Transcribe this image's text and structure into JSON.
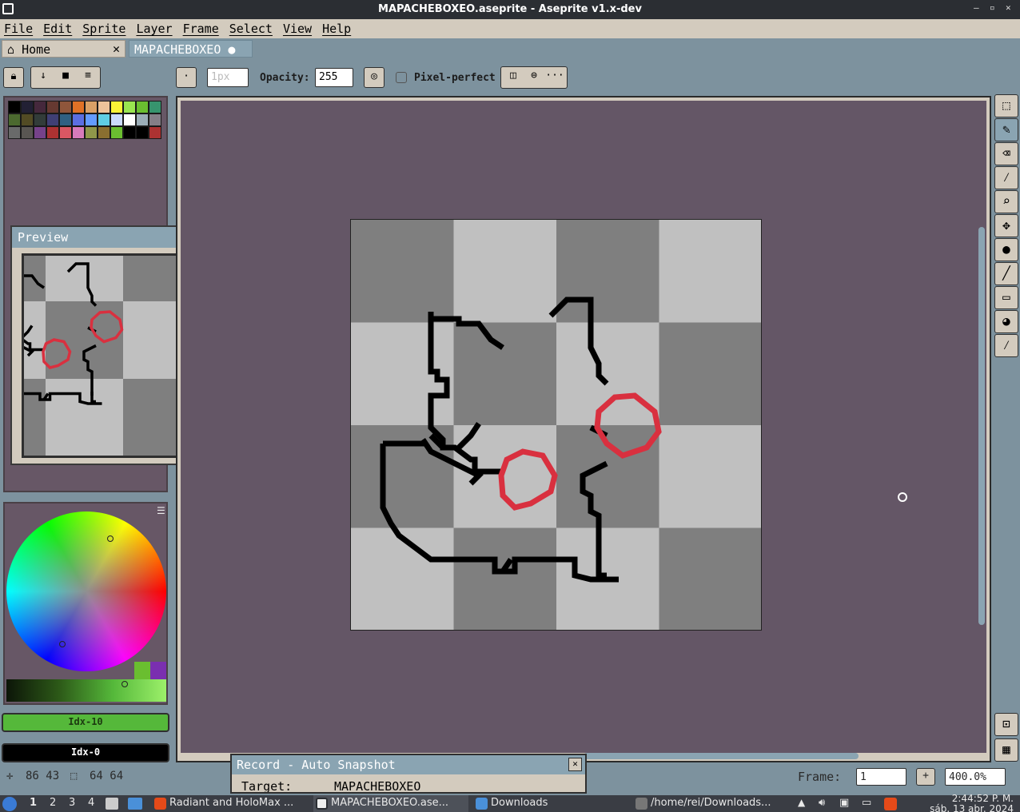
{
  "window": {
    "title": "MAPACHEBOXEO.aseprite - Aseprite v1.x-dev",
    "minimize": "–",
    "restore": "▫",
    "close": "✕"
  },
  "menu": [
    "File",
    "Edit",
    "Sprite",
    "Layer",
    "Frame",
    "Select",
    "View",
    "Help"
  ],
  "tabs": {
    "home_label": "Home",
    "home_close": "✕",
    "file_label": "MAPACHEBOXEO",
    "file_modified": "●"
  },
  "context_bar": {
    "brush_size": "1px",
    "opacity_label": "Opacity:",
    "opacity_value": "255",
    "pixel_perfect_label": "Pixel-perfect",
    "more": "···"
  },
  "palette_colors": [
    "#000000",
    "#222034",
    "#45283c",
    "#663931",
    "#8f563b",
    "#df7126",
    "#d9a066",
    "#eec39a",
    "#fbf236",
    "#99e550",
    "#6abe30",
    "#37946e",
    "#4b692f",
    "#524b24",
    "#323c39",
    "#3f3f74",
    "#306082",
    "#5b6ee1",
    "#639bff",
    "#5fcde4",
    "#cbdbfc",
    "#ffffff",
    "#9badb7",
    "#847e87",
    "#696a6a",
    "#595652",
    "#76428a",
    "#ac3232",
    "#d95763",
    "#d77bba",
    "#8f974a",
    "#8a6f30",
    "#6abe30",
    "#000000",
    "#000000",
    "#ac3232"
  ],
  "preview": {
    "title": "Preview"
  },
  "colors": {
    "fg_label": "Idx-10",
    "bg_label": "Idx-0",
    "fg": "#55b83a",
    "bg": "#000000",
    "outline": "#000000",
    "red": "#d9303f"
  },
  "status": {
    "pos_icon": "✛",
    "pos": "86 43",
    "size_icon": "⬚",
    "size": "64 64",
    "frame_label": "Frame:",
    "frame_value": "1",
    "add": "+",
    "zoom": "400.0%"
  },
  "record": {
    "title": "Record - Auto Snapshot",
    "target_label": "Target:",
    "target_value": "MAPACHEBOXEO",
    "close": "✕"
  },
  "tools": [
    "selection-tool-icon",
    "pencil-icon",
    "eraser-icon",
    "eyedropper-icon",
    "zoom-icon",
    "move-icon",
    "paint-bucket-icon",
    "line-icon",
    "rectangle-icon",
    "contour-icon",
    "blur-icon"
  ],
  "taskbar": {
    "workspaces": [
      "1",
      "2",
      "3",
      "4"
    ],
    "windows": [
      {
        "label": "Radiant and HoloMax ...",
        "icon_color": "#e64a19"
      },
      {
        "label": "MAPACHEBOXEO.ase...",
        "icon_color": "#2b2e33"
      },
      {
        "label": "Downloads",
        "icon_color": "#4a90d9"
      },
      {
        "label": "/home/rei/Downloads...",
        "icon_color": "#777777"
      }
    ],
    "clock": "2:44:52 P. M.",
    "date": "sáb. 13 abr. 2024"
  }
}
